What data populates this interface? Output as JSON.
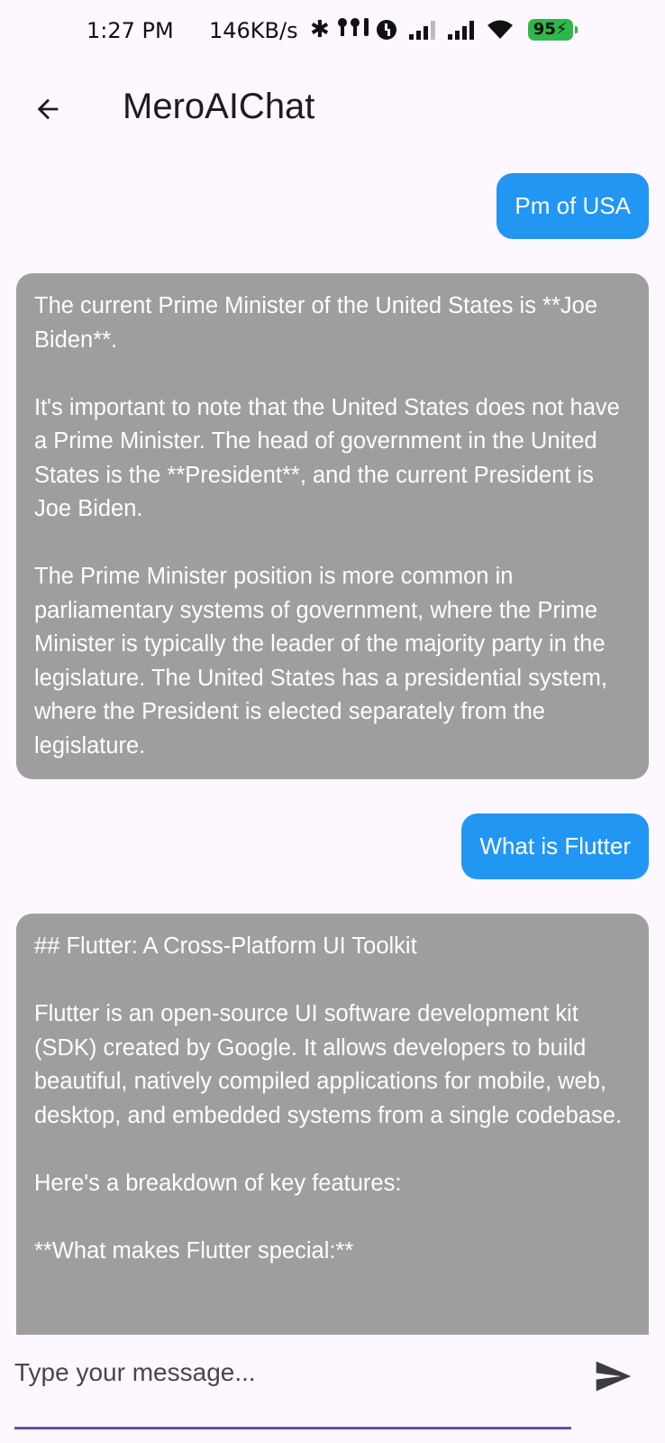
{
  "status_bar": {
    "time": "1:27 PM",
    "network_speed": "146KB/s",
    "battery": "95",
    "icons": [
      "bluetooth-icon",
      "earbuds-icon",
      "alarm-icon",
      "signal-icon",
      "signal-icon",
      "wifi-icon",
      "battery-icon"
    ]
  },
  "app_bar": {
    "back_icon": "arrow-back-icon",
    "title": "MeroAIChat"
  },
  "messages": [
    {
      "role": "user",
      "text": "Pm of USA"
    },
    {
      "role": "bot",
      "text": "The current Prime Minister of the United States is **Joe Biden**.\n\nIt's important to note that the United States does not have a Prime Minister. The head of government in the United States is the **President**, and the current President is Joe Biden.\n\nThe Prime Minister position is more common in parliamentary systems of government, where the Prime Minister is typically the leader of the majority party in the legislature. The United States has a presidential system, where the President is elected separately from the legislature.\n"
    },
    {
      "role": "user",
      "text": "What is Flutter"
    },
    {
      "role": "bot",
      "text": "## Flutter: A Cross-Platform UI Toolkit\n\nFlutter is an open-source UI software development kit (SDK) created by Google. It allows developers to build beautiful, natively compiled applications for mobile, web, desktop, and embedded systems from a single codebase.\n\nHere's a breakdown of key features:\n\n**What makes Flutter special:**"
    }
  ],
  "input": {
    "placeholder": "Type your message...",
    "value": "",
    "send_icon": "send-icon"
  },
  "colors": {
    "background": "#fdf7ff",
    "user_bubble": "#2196f3",
    "bot_bubble": "#9e9e9e",
    "input_underline": "#6750a4"
  }
}
